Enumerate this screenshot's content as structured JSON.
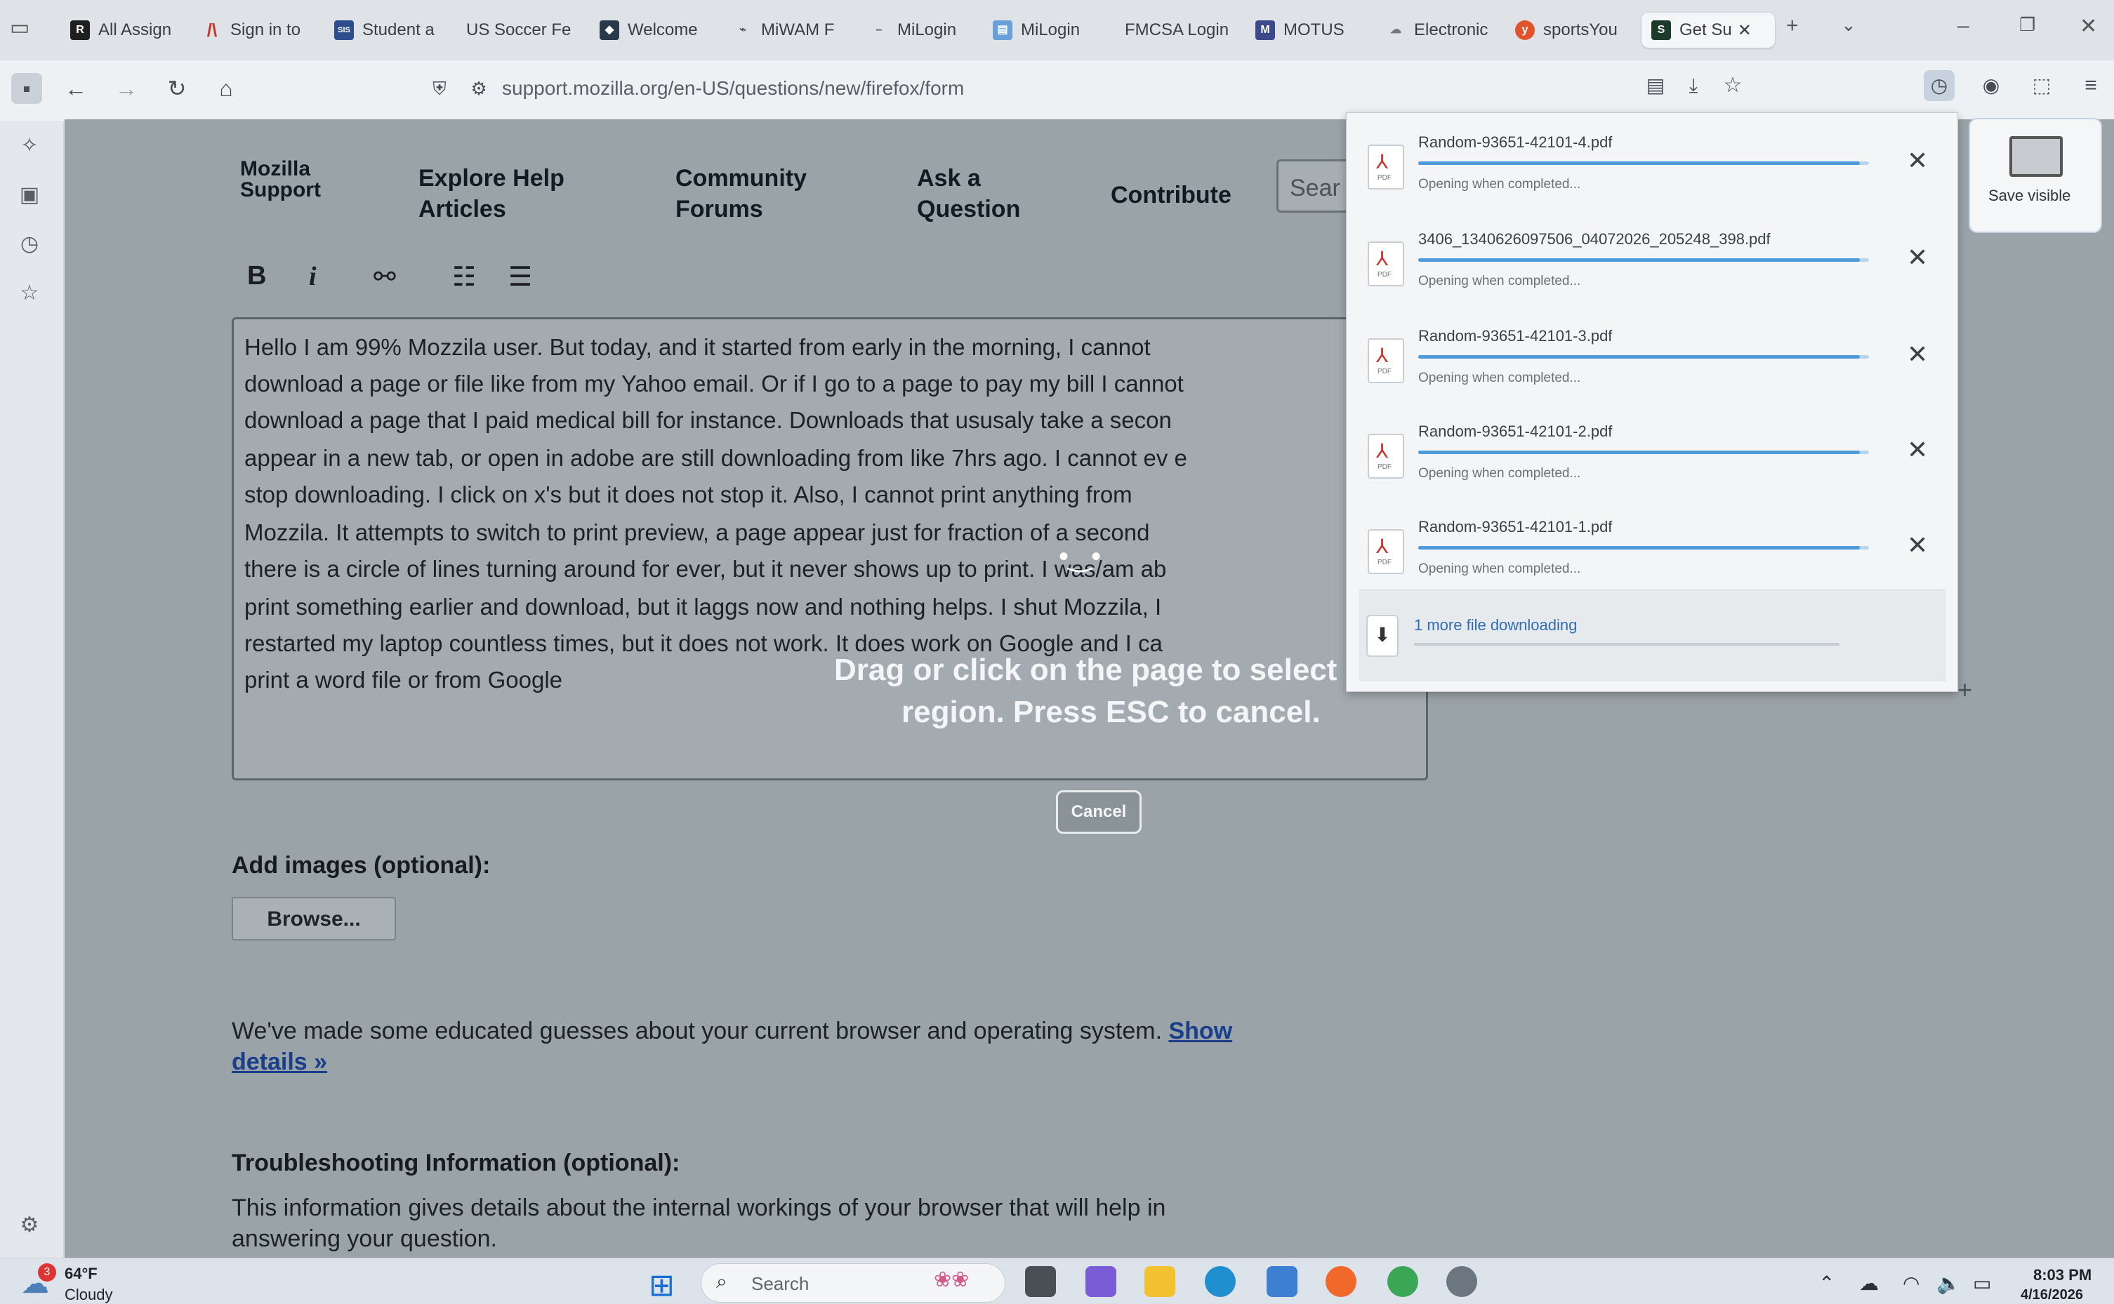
{
  "colors": {
    "accent": "#4f9bd9",
    "pdf_red": "#d0312d",
    "link": "#1a3f8a"
  },
  "tabs": [
    {
      "label": "All Assign",
      "icon": "r-logo-icon"
    },
    {
      "label": "Sign in to",
      "icon": "canvas-icon"
    },
    {
      "label": "Student a",
      "icon": "sis-icon"
    },
    {
      "label": "US Soccer Fe",
      "icon": "soccer-icon"
    },
    {
      "label": "Welcome",
      "icon": "welcome-icon"
    },
    {
      "label": "MiWAM F",
      "icon": "miwam-icon"
    },
    {
      "label": "MiLogin",
      "icon": "milogin-icon"
    },
    {
      "label": "MiLogin",
      "icon": "milogin-icon"
    },
    {
      "label": "FMCSA Login",
      "icon": "fmcsa-icon"
    },
    {
      "label": "MOTUS",
      "icon": "motus-icon"
    },
    {
      "label": "Electronic",
      "icon": "electronic-icon"
    },
    {
      "label": "sportsYou",
      "icon": "sportsyou-icon"
    },
    {
      "label": "Get Su",
      "icon": "support-icon"
    }
  ],
  "url": "support.mozilla.org/en-US/questions/new/firefox/form",
  "site_nav": {
    "logo_line1": "Mozilla",
    "logo_line2": "Support",
    "explore_line1": "Explore Help",
    "explore_line2": "Articles",
    "community_line1": "Community",
    "community_line2": "Forums",
    "ask_line1": "Ask a",
    "ask_line2": "Question",
    "contribute": "Contribute",
    "search_placeholder": "Sear"
  },
  "editor_toolbar": {
    "bold": "B",
    "italic": "i"
  },
  "editor_lines": [
    "Hello I am 99% Mozzila user. But today, and it started from early in the morning, I cannot",
    "download a page or file like from my Yahoo email. Or if I go to a page to pay my bill I cannot",
    "download a page that I paid medical bill for instance. Downloads that ususaly take a secon",
    "appear in a new tab, or open in adobe are still downloading from like 7hrs ago. I cannot ev e",
    "stop downloading. I click on x's but it does not stop it. Also, I cannot print anything from",
    "Mozzila. It attempts to switch to print preview, a page appear just for fraction of a second",
    "there is a circle of lines turning around for ever, but it never shows up to print. I was/am ab",
    "print something earlier and download, but it laggs now and nothing helps. I shut Mozzila, I",
    "restarted my laptop countless times, but it does not work. It does work on Google and I ca",
    "print a word file or from Google"
  ],
  "overlay": {
    "line1": "Drag or click on the page to select",
    "line2": "region. Press ESC to cancel.",
    "cancel": "Cancel",
    "save_visible": "Save visible"
  },
  "form": {
    "add_images_label": "Add images (optional):",
    "browse": "Browse...",
    "guess_text": "We've made some educated guesses about your current browser and operating system.",
    "show_link1": "Show",
    "show_link2": "details »",
    "troubleshoot_label": "Troubleshooting Information (optional):",
    "troubleshoot_line1": "This information gives details about the internal workings of your browser that will help in",
    "troubleshoot_line2": "answering your question."
  },
  "downloads": {
    "items": [
      {
        "name": "Random-93651-42101-4.pdf",
        "status": "Opening when completed...",
        "progress": 0.98
      },
      {
        "name": "3406_1340626097506_04072026_205248_398.pdf",
        "status": "Opening when completed...",
        "progress": 0.98
      },
      {
        "name": "Random-93651-42101-3.pdf",
        "status": "Opening when completed...",
        "progress": 0.98
      },
      {
        "name": "Random-93651-42101-2.pdf",
        "status": "Opening when completed...",
        "progress": 0.98
      },
      {
        "name": "Random-93651-42101-1.pdf",
        "status": "Opening when completed...",
        "progress": 0.98
      }
    ],
    "more": "1 more file downloading"
  },
  "taskbar": {
    "weather_badge": "3",
    "temp": "64°F",
    "condition": "Cloudy",
    "search": "Search",
    "time": "8:03 PM",
    "date": "4/16/2026"
  }
}
